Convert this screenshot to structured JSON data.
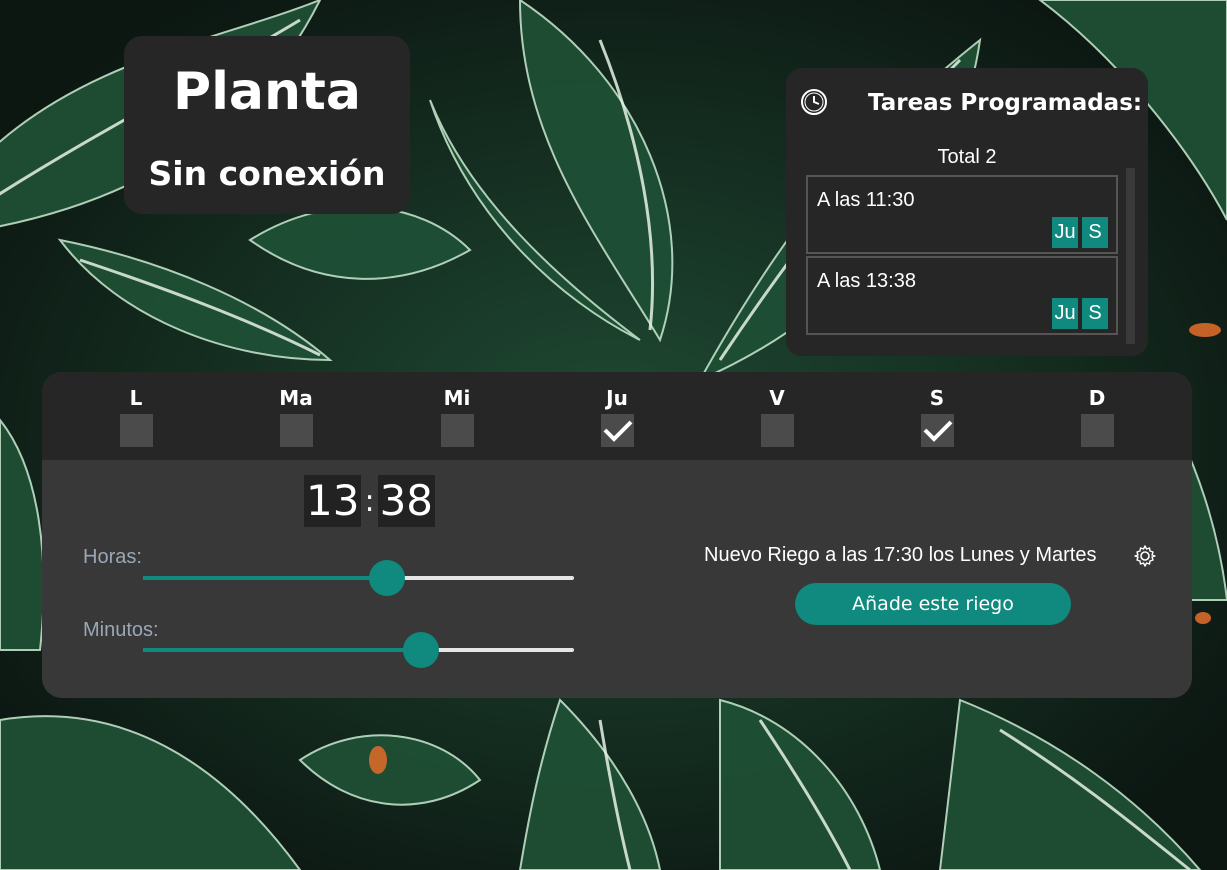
{
  "status": {
    "title": "Planta",
    "connection": "Sin conexión"
  },
  "tasks": {
    "icon": "clock-icon",
    "title": "Tareas Programadas:",
    "total": "Total 2",
    "items": [
      {
        "time": "A las 11:30",
        "days": [
          "Ju",
          "S"
        ]
      },
      {
        "time": "A las 13:38",
        "days": [
          "Ju",
          "S"
        ]
      }
    ]
  },
  "week": {
    "days": [
      {
        "label": "L",
        "checked": false
      },
      {
        "label": "Ma",
        "checked": false
      },
      {
        "label": "Mi",
        "checked": false
      },
      {
        "label": "Ju",
        "checked": true
      },
      {
        "label": "V",
        "checked": false
      },
      {
        "label": "S",
        "checked": true
      },
      {
        "label": "D",
        "checked": false
      }
    ]
  },
  "clock": {
    "hours": "13",
    "minutes": "38",
    "separator": ":"
  },
  "sliders": {
    "hours": {
      "label": "Horas:",
      "value": 13,
      "max": 23
    },
    "minutes": {
      "label": "Minutos:",
      "value": 38,
      "max": 59
    }
  },
  "new_irrigation": {
    "text": "Nuevo Riego a las 17:30 los Lunes y Martes",
    "settings_icon": "gear-icon",
    "add_button": "Añade este riego"
  },
  "colors": {
    "accent": "#10897e",
    "panel": "#262626",
    "panel_light": "#383838"
  }
}
